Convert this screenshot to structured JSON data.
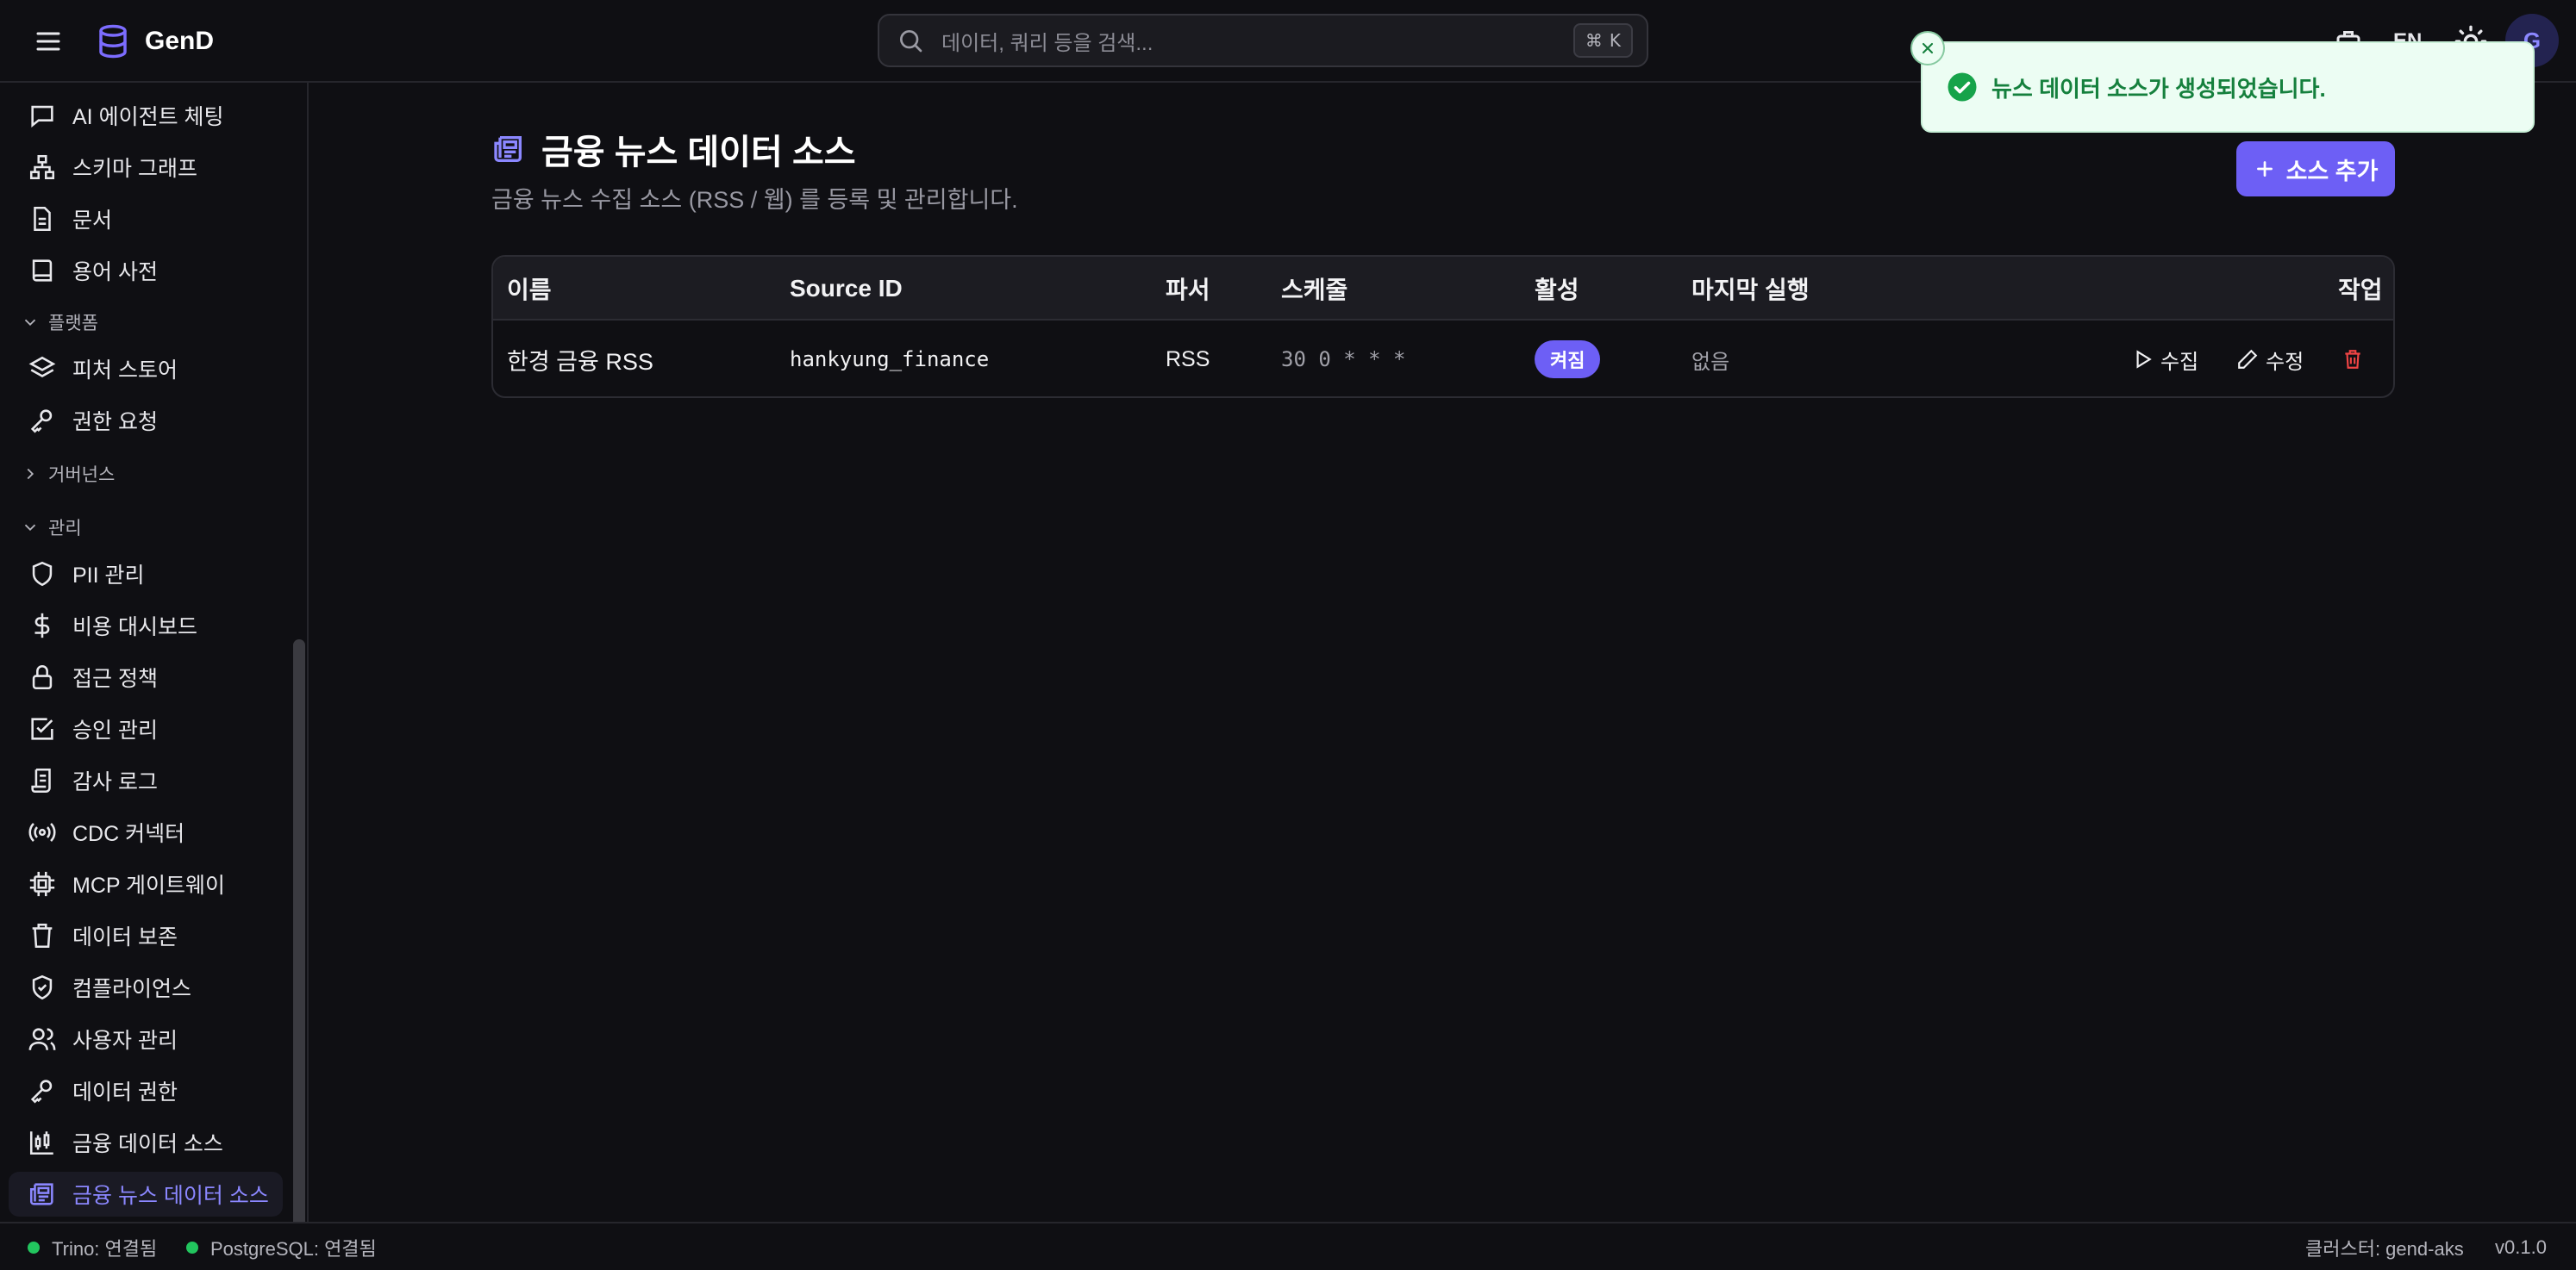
{
  "app": {
    "name": "GenD"
  },
  "search": {
    "placeholder": "데이터, 쿼리 등을 검색...",
    "shortcut_key": "K"
  },
  "header": {
    "language": "EN",
    "avatar_initial": "G"
  },
  "sidebar": {
    "items_top": [
      {
        "label": "AI 에이전트 체팅",
        "icon": "chat-icon"
      },
      {
        "label": "스키마 그래프",
        "icon": "schema-graph-icon"
      },
      {
        "label": "문서",
        "icon": "document-icon"
      },
      {
        "label": "용어 사전",
        "icon": "book-icon"
      }
    ],
    "section_platform": "플랫폼",
    "items_platform": [
      {
        "label": "피처 스토어",
        "icon": "layers-icon"
      },
      {
        "label": "권한 요청",
        "icon": "key-icon"
      }
    ],
    "section_governance": "거버넌스",
    "section_admin": "관리",
    "items_admin": [
      {
        "label": "PII 관리",
        "icon": "shield-icon"
      },
      {
        "label": "비용 대시보드",
        "icon": "dollar-icon"
      },
      {
        "label": "접근 정책",
        "icon": "lock-icon"
      },
      {
        "label": "승인 관리",
        "icon": "check-square-icon"
      },
      {
        "label": "감사 로그",
        "icon": "scroll-icon"
      },
      {
        "label": "CDC 커넥터",
        "icon": "radio-icon"
      },
      {
        "label": "MCP 게이트웨이",
        "icon": "cpu-icon"
      },
      {
        "label": "데이터 보존",
        "icon": "trash-icon"
      },
      {
        "label": "컴플라이언스",
        "icon": "shield-check-icon"
      },
      {
        "label": "사용자 관리",
        "icon": "users-icon"
      },
      {
        "label": "데이터 권한",
        "icon": "key-icon"
      },
      {
        "label": "금융 데이터 소스",
        "icon": "candlestick-icon"
      },
      {
        "label": "금융 뉴스 데이터 소스",
        "icon": "newspaper-icon",
        "active": true
      }
    ]
  },
  "page": {
    "title": "금융 뉴스 데이터 소스",
    "subtitle": "금융 뉴스 수집 소스 (RSS / 웹) 를 등록 및 관리합니다.",
    "add_button": "소스 추가"
  },
  "table": {
    "headers": {
      "name": "이름",
      "source_id": "Source ID",
      "parser": "파서",
      "schedule": "스케줄",
      "active": "활성",
      "last_run": "마지막 실행",
      "actions": "작업"
    },
    "rows": [
      {
        "name": "한경 금융 RSS",
        "source_id": "hankyung_finance",
        "parser": "RSS",
        "schedule": "30 0 * * *",
        "active": "켜짐",
        "last_run": "없음",
        "collect": "수집",
        "edit": "수정"
      }
    ]
  },
  "toast": {
    "message": "뉴스 데이터 소스가 생성되었습니다."
  },
  "footer": {
    "trino": "Trino: 연결됨",
    "postgres": "PostgreSQL: 연결됨",
    "cluster": "클러스터: gend-aks",
    "version": "v0.1.0"
  },
  "colors": {
    "accent": "#6d5ff5",
    "active_text": "#8b87ff",
    "status_ok": "#22c55e",
    "toast_bg": "#ecfdf3",
    "danger": "#ef4444"
  }
}
